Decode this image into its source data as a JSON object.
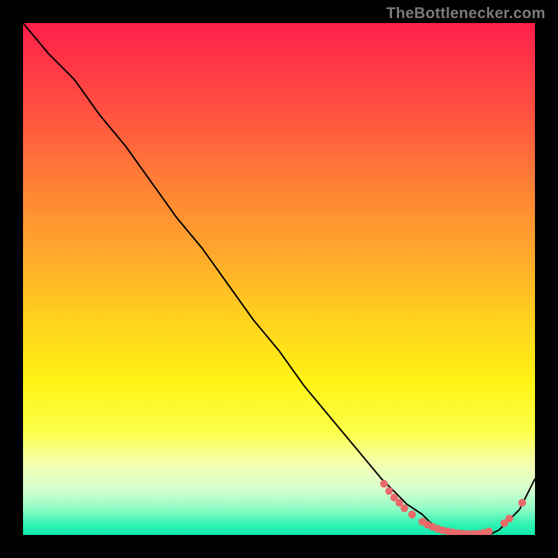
{
  "watermark": "TheBottlenecker.com",
  "chart_data": {
    "type": "line",
    "title": "",
    "xlabel": "",
    "ylabel": "",
    "xlim": [
      0,
      100
    ],
    "ylim": [
      0,
      100
    ],
    "series": [
      {
        "name": "bottleneck-curve",
        "x": [
          0,
          5,
          10,
          15,
          20,
          25,
          30,
          35,
          40,
          45,
          50,
          55,
          60,
          65,
          70,
          72,
          75,
          78,
          80,
          83,
          86,
          89,
          91,
          93,
          95,
          97,
          100
        ],
        "y": [
          100,
          94,
          89,
          82,
          76,
          69,
          62,
          56,
          49,
          42,
          36,
          29,
          23,
          17,
          11,
          9,
          6,
          4,
          2,
          1,
          0,
          0,
          0,
          1,
          3,
          5,
          11
        ]
      }
    ],
    "markers": [
      {
        "x": 70.5,
        "y": 10.0
      },
      {
        "x": 71.5,
        "y": 8.6
      },
      {
        "x": 72.5,
        "y": 7.3
      },
      {
        "x": 73.5,
        "y": 6.3
      },
      {
        "x": 74.5,
        "y": 5.2
      },
      {
        "x": 76.0,
        "y": 4.0
      },
      {
        "x": 78.0,
        "y": 2.6
      },
      {
        "x": 79.0,
        "y": 2.0
      },
      {
        "x": 80.0,
        "y": 1.6
      },
      {
        "x": 81.0,
        "y": 1.2
      },
      {
        "x": 82.0,
        "y": 0.9
      },
      {
        "x": 83.0,
        "y": 0.7
      },
      {
        "x": 84.0,
        "y": 0.5
      },
      {
        "x": 85.0,
        "y": 0.35
      },
      {
        "x": 86.0,
        "y": 0.25
      },
      {
        "x": 87.0,
        "y": 0.2
      },
      {
        "x": 88.0,
        "y": 0.2
      },
      {
        "x": 89.0,
        "y": 0.25
      },
      {
        "x": 90.0,
        "y": 0.4
      },
      {
        "x": 91.0,
        "y": 0.7
      },
      {
        "x": 94.0,
        "y": 2.3
      },
      {
        "x": 95.0,
        "y": 3.2
      },
      {
        "x": 97.5,
        "y": 6.3
      }
    ],
    "gradient_stops": [
      {
        "pos": 0.0,
        "color": "#ff1f4a"
      },
      {
        "pos": 0.08,
        "color": "#ff3646"
      },
      {
        "pos": 0.2,
        "color": "#ff5a3f"
      },
      {
        "pos": 0.32,
        "color": "#ff8235"
      },
      {
        "pos": 0.44,
        "color": "#ffa52c"
      },
      {
        "pos": 0.58,
        "color": "#ffd21e"
      },
      {
        "pos": 0.7,
        "color": "#fff314"
      },
      {
        "pos": 0.8,
        "color": "#fcff4a"
      },
      {
        "pos": 0.86,
        "color": "#f5ffb0"
      },
      {
        "pos": 0.91,
        "color": "#d8ffcf"
      },
      {
        "pos": 0.95,
        "color": "#8dfcc5"
      },
      {
        "pos": 0.98,
        "color": "#2ef3b4"
      },
      {
        "pos": 1.0,
        "color": "#11e9ad"
      }
    ],
    "marker_color": "#e86a6a",
    "curve_color": "#000000"
  }
}
